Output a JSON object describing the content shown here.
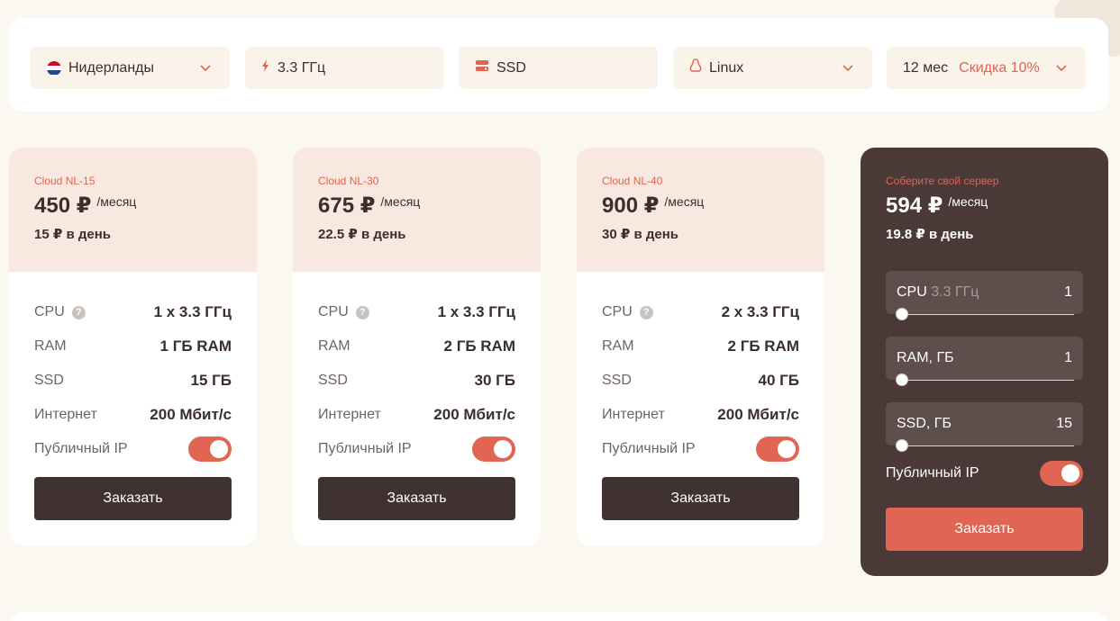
{
  "filters": {
    "location": "Нидерланды",
    "cpu": "3.3 ГГц",
    "disk": "SSD",
    "os": "Linux",
    "period": "12 мес",
    "discount": "Скидка 10%"
  },
  "colors": {
    "accent": "#e06552",
    "dark": "#3f3231",
    "card_head": "#f8e8df",
    "custom_bg": "#4a3937"
  },
  "plans": [
    {
      "name": "Cloud NL-15",
      "price": "450 ₽",
      "per": "/месяц",
      "per_day": "15 ₽ в день",
      "specs": {
        "cpu_label": "CPU",
        "cpu": "1 x 3.3 ГГц",
        "ram_label": "RAM",
        "ram": "1 ГБ RAM",
        "ssd_label": "SSD",
        "ssd": "15 ГБ",
        "net_label": "Интернет",
        "net": "200 Мбит/с",
        "ip_label": "Публичный IP"
      },
      "order": "Заказать"
    },
    {
      "name": "Cloud NL-30",
      "price": "675 ₽",
      "per": "/месяц",
      "per_day": "22.5 ₽ в день",
      "specs": {
        "cpu_label": "CPU",
        "cpu": "1 x 3.3 ГГц",
        "ram_label": "RAM",
        "ram": "2 ГБ RAM",
        "ssd_label": "SSD",
        "ssd": "30 ГБ",
        "net_label": "Интернет",
        "net": "200 Мбит/с",
        "ip_label": "Публичный IP"
      },
      "order": "Заказать"
    },
    {
      "name": "Cloud NL-40",
      "price": "900 ₽",
      "per": "/месяц",
      "per_day": "30 ₽ в день",
      "specs": {
        "cpu_label": "CPU",
        "cpu": "2 x 3.3 ГГц",
        "ram_label": "RAM",
        "ram": "2 ГБ RAM",
        "ssd_label": "SSD",
        "ssd": "40 ГБ",
        "net_label": "Интернет",
        "net": "200 Мбит/с",
        "ip_label": "Публичный IP"
      },
      "order": "Заказать"
    }
  ],
  "custom": {
    "name": "Соберите свой сервер",
    "price": "594 ₽",
    "per": "/месяц",
    "per_day": "19.8 ₽ в день",
    "cpu_label": "CPU",
    "cpu_sub": "3.3 ГГц",
    "cpu_val": "1",
    "ram_label": "RAM, ГБ",
    "ram_val": "1",
    "ssd_label": "SSD, ГБ",
    "ssd_val": "15",
    "ip_label": "Публичный IP",
    "order": "Заказать"
  }
}
